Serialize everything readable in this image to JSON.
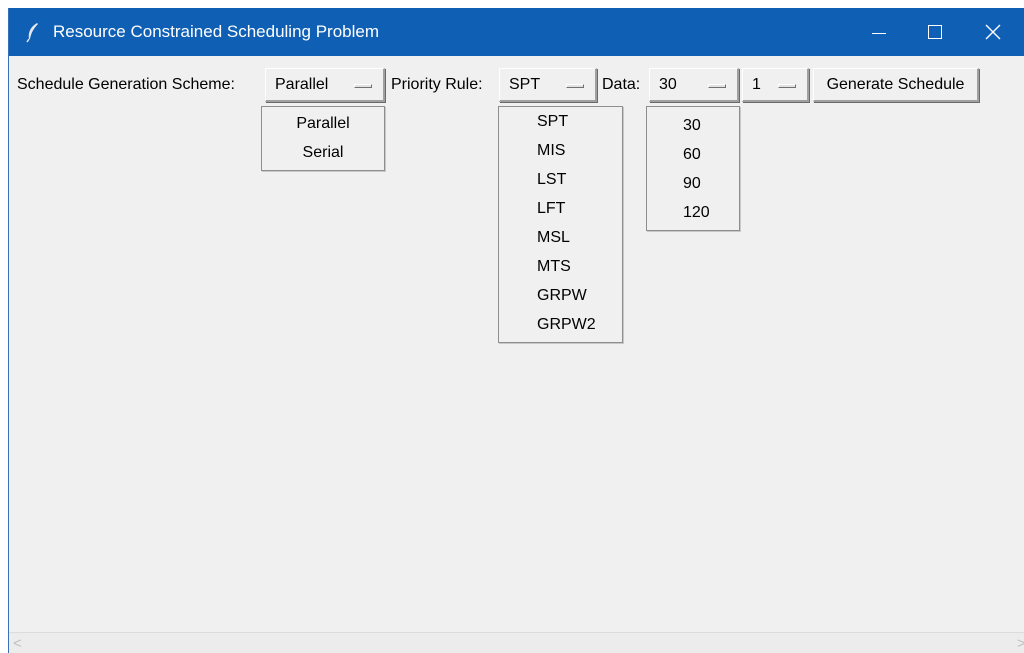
{
  "window": {
    "title": "Resource Constrained Scheduling Problem",
    "titlebar_color": "#0f5fb4",
    "icon": "feather-icon"
  },
  "toolbar": {
    "sgs_label": "Schedule Generation Scheme:",
    "sgs_value": "Parallel",
    "priority_label": "Priority Rule:",
    "priority_value": "SPT",
    "data_label": "Data:",
    "data_value": "30",
    "instance_value": "1",
    "generate_label": "Generate Schedule"
  },
  "menus": {
    "sgs_options": [
      "Parallel",
      "Serial"
    ],
    "priority_options": [
      "SPT",
      "MIS",
      "LST",
      "LFT",
      "MSL",
      "MTS",
      "GRPW",
      "GRPW2"
    ],
    "data_options": [
      "30",
      "60",
      "90",
      "120"
    ]
  },
  "scrollbar": {
    "left_arrow": "<",
    "right_arrow": ">"
  }
}
